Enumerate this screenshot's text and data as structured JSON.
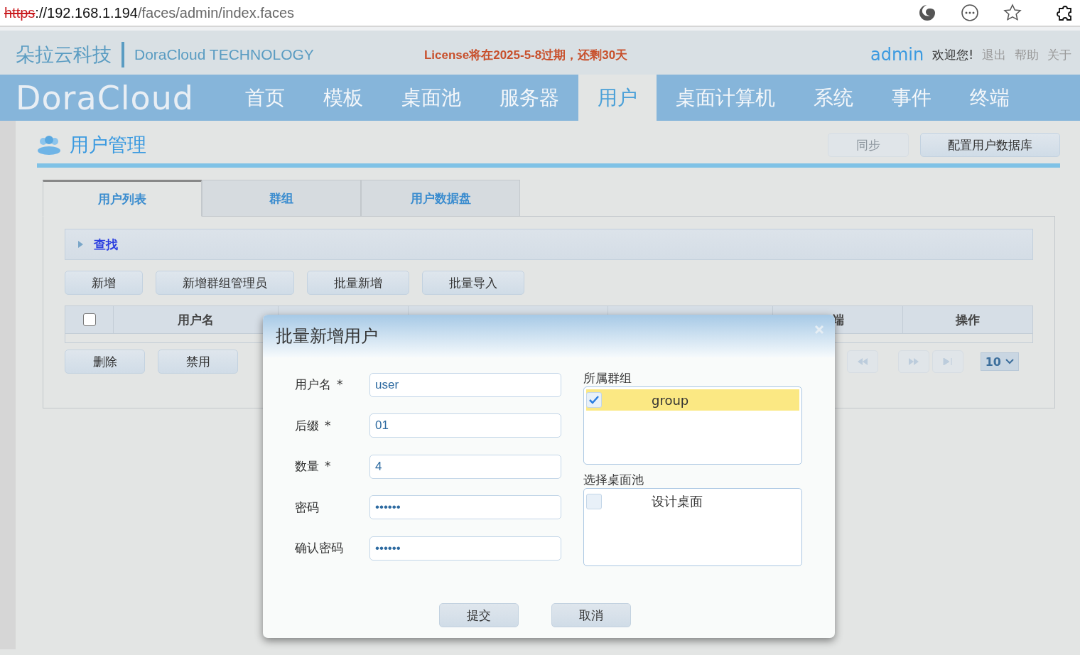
{
  "browser": {
    "url": {
      "scheme": "https",
      "secure": false,
      "host": "://192.168.1.194",
      "path": "/faces/admin/index.faces"
    }
  },
  "header": {
    "brand_cn": "朵拉云科技",
    "brand_en": "DoraCloud TECHNOLOGY",
    "license_notice": "License将在2025-5-8过期，还剩30天",
    "user": "admin",
    "welcome": "欢迎您!",
    "links": [
      "退出",
      "帮助",
      "关于"
    ]
  },
  "nav": {
    "logo": "DoraCloud",
    "items": [
      {
        "label": "首页",
        "selected": false
      },
      {
        "label": "模板",
        "selected": false
      },
      {
        "label": "桌面池",
        "selected": false
      },
      {
        "label": "服务器",
        "selected": false
      },
      {
        "label": "用户",
        "selected": true
      },
      {
        "label": "桌面计算机",
        "selected": false
      },
      {
        "label": "系统",
        "selected": false
      },
      {
        "label": "事件",
        "selected": false
      },
      {
        "label": "终端",
        "selected": false
      }
    ]
  },
  "page": {
    "title": "用户管理",
    "actions": [
      {
        "label": "同步",
        "disabled": true
      },
      {
        "label": "配置用户数据库",
        "disabled": false
      }
    ]
  },
  "tabs": [
    {
      "label": "用户列表",
      "selected": true
    },
    {
      "label": "群组",
      "selected": false
    },
    {
      "label": "用户数据盘",
      "selected": false
    }
  ],
  "search_panel": {
    "label": "查找",
    "expanded": false
  },
  "toolbar": [
    "新增",
    "新增群组管理员",
    "批量新增",
    "批量导入"
  ],
  "table": {
    "select_all": false,
    "columns": [
      {
        "label": "用户名"
      },
      {
        "label": "端"
      },
      {
        "label": "操作"
      }
    ]
  },
  "bottom_buttons": [
    "删除",
    "禁用"
  ],
  "pager": {
    "page_size": "10"
  },
  "dialog": {
    "title": "批量新增用户",
    "fields": [
      {
        "label": "用户名",
        "required_mark": "*",
        "value": "user"
      },
      {
        "label": "后缀",
        "required_mark": "*",
        "value": "01"
      },
      {
        "label": "数量",
        "required_mark": "*",
        "value": "4"
      },
      {
        "label": "密码",
        "value": "••••••"
      },
      {
        "label": "确认密码",
        "value": "••••••"
      }
    ],
    "lists": [
      {
        "label": "所属群组",
        "items": [
          {
            "label": "group",
            "checked": true,
            "selected": true
          }
        ]
      },
      {
        "label": "选择桌面池",
        "items": [
          {
            "label": "设计桌面",
            "checked": false,
            "selected": false
          }
        ]
      }
    ],
    "buttons": [
      "提交",
      "取消"
    ]
  }
}
